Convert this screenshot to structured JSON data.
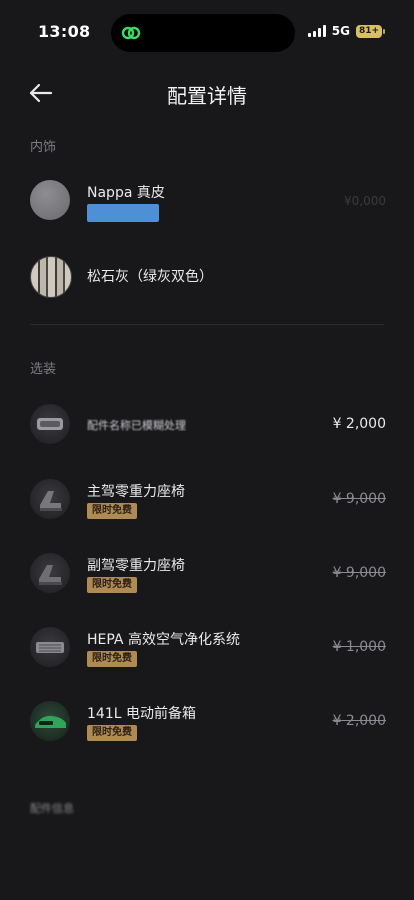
{
  "status_bar": {
    "time": "13:08",
    "network": "5G",
    "battery": "81+"
  },
  "header": {
    "title": "配置详情",
    "back_icon": "arrow-left-icon"
  },
  "sections": {
    "interior": {
      "label": "内饰",
      "items": [
        {
          "name": "Nappa 真皮",
          "faint_price": "¥0,000"
        },
        {
          "name": "松石灰（绿灰双色）"
        }
      ]
    },
    "options": {
      "label": "选装",
      "items": [
        {
          "name": "配件名称已模糊处理",
          "price": "¥ 2,000",
          "badge": "",
          "strike": false
        },
        {
          "name": "主驾零重力座椅",
          "price": "¥ 9,000",
          "badge": "限时免费",
          "strike": true
        },
        {
          "name": "副驾零重力座椅",
          "price": "¥ 9,000",
          "badge": "限时免费",
          "strike": true
        },
        {
          "name": "HEPA 高效空气净化系统",
          "price": "¥ 1,000",
          "badge": "限时免费",
          "strike": true
        },
        {
          "name": "141L 电动前备箱",
          "price": "¥ 2,000",
          "badge": "限时免费",
          "strike": true
        }
      ]
    },
    "bottom_blur": "配件信息"
  },
  "colors": {
    "background": "#18181a",
    "badge": "#b08a53",
    "blue_bar": "#4f8fd6"
  }
}
